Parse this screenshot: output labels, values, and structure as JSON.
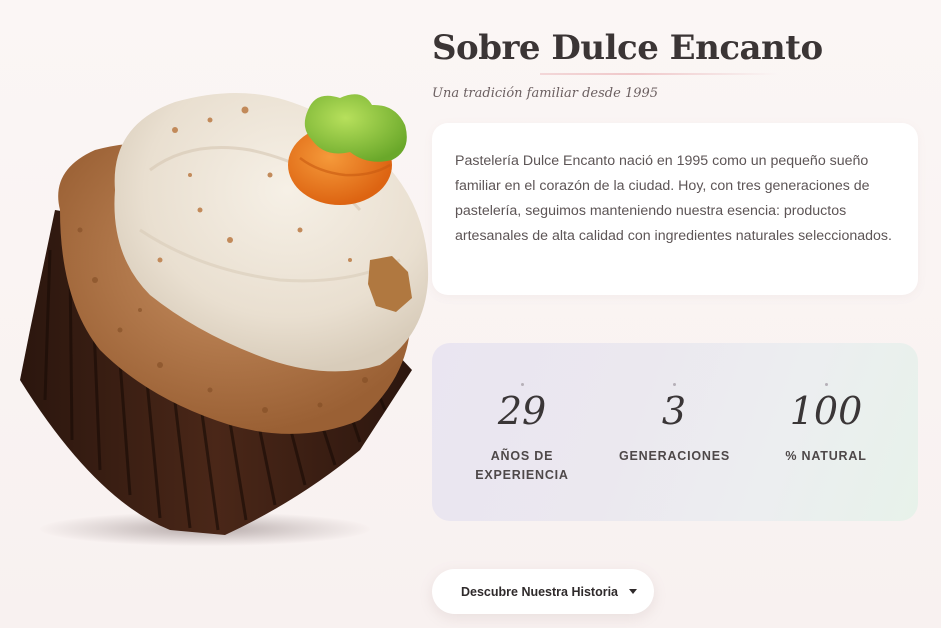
{
  "about": {
    "title": "Sobre Dulce Encanto",
    "subtitle": "Una tradición familiar desde 1995",
    "description": "Pastelería Dulce Encanto nació en 1995 como un pequeño sueño familiar en el corazón de la ciudad. Hoy, con tres generaciones de pastelería, seguimos manteniendo nuestra esencia: productos artesanales de alta calidad con ingredientes naturales seleccionados."
  },
  "stats": [
    {
      "number": "29",
      "label": "AÑOS DE EXPERIENCIA"
    },
    {
      "number": "3",
      "label": "GENERACIONES"
    },
    {
      "number": "100",
      "label": "% NATURAL"
    }
  ],
  "cta": {
    "label": "Descubre Nuestra Historia",
    "icon": "caret-down-icon"
  },
  "image": {
    "subject": "carrot-cupcake-image"
  },
  "colors": {
    "background": "#fbf6f5",
    "card": "#ffffff",
    "text_dark": "#3b3535",
    "accent_rule": "#f0c8ca"
  }
}
